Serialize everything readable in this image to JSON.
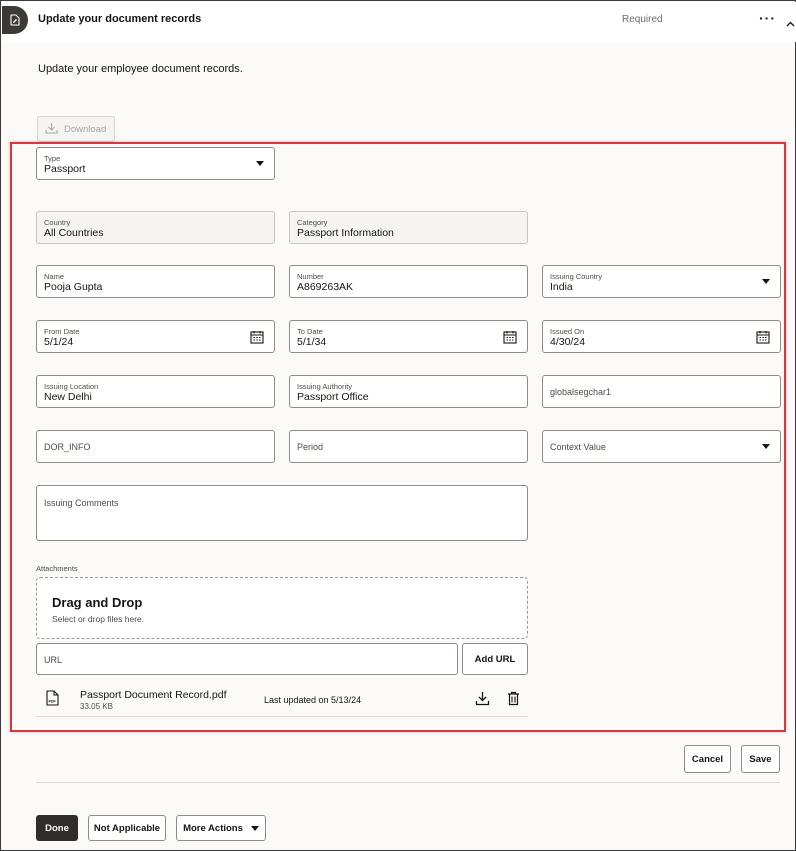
{
  "header": {
    "title": "Update your document records",
    "status": "Required",
    "more_label": "···"
  },
  "subtitle": "Update your employee document records.",
  "toolbar": {
    "download_label": "Download"
  },
  "form": {
    "type": {
      "label": "Type",
      "value": "Passport"
    },
    "country": {
      "label": "Country",
      "value": "All Countries"
    },
    "category": {
      "label": "Category",
      "value": "Passport Information"
    },
    "name": {
      "label": "Name",
      "value": "Pooja Gupta"
    },
    "number": {
      "label": "Number",
      "value": "A869263AK"
    },
    "issuing_country": {
      "label": "Issuing Country",
      "value": "India"
    },
    "from_date": {
      "label": "From Date",
      "value": "5/1/24"
    },
    "to_date": {
      "label": "To Date",
      "value": "5/1/34"
    },
    "issued_on": {
      "label": "Issued On",
      "value": "4/30/24"
    },
    "issuing_location": {
      "label": "Issuing Location",
      "value": "New Delhi"
    },
    "issuing_authority": {
      "label": "Issuing Authority",
      "value": "Passport Office"
    },
    "globalsegchar1": {
      "placeholder": "globalsegchar1"
    },
    "dor_info": {
      "placeholder": "DOR_INFO"
    },
    "period": {
      "placeholder": "Period"
    },
    "context_value": {
      "placeholder": "Context Value"
    },
    "issuing_comments": {
      "placeholder": "Issuing Comments"
    }
  },
  "attachments": {
    "label": "Attachments",
    "dropzone_title": "Drag and Drop",
    "dropzone_sub": "Select or drop files here.",
    "url_placeholder": "URL",
    "add_url_label": "Add URL",
    "files": [
      {
        "name": "Passport Document Record.pdf",
        "size": "33.05 KB",
        "updated": "Last updated on 5/13/24"
      }
    ]
  },
  "actions": {
    "cancel_label": "Cancel",
    "save_label": "Save"
  },
  "footer": {
    "done_label": "Done",
    "not_applicable_label": "Not Applicable",
    "more_actions_label": "More Actions"
  },
  "colors": {
    "highlight_border": "#d9363e",
    "primary_button": "#312d2a",
    "field_border": "#8f8b86"
  },
  "icons": {
    "header": "document-edit-icon",
    "download": "download-icon",
    "calendar": "calendar-icon",
    "file": "pdf-file-icon",
    "delete": "trash-icon"
  }
}
